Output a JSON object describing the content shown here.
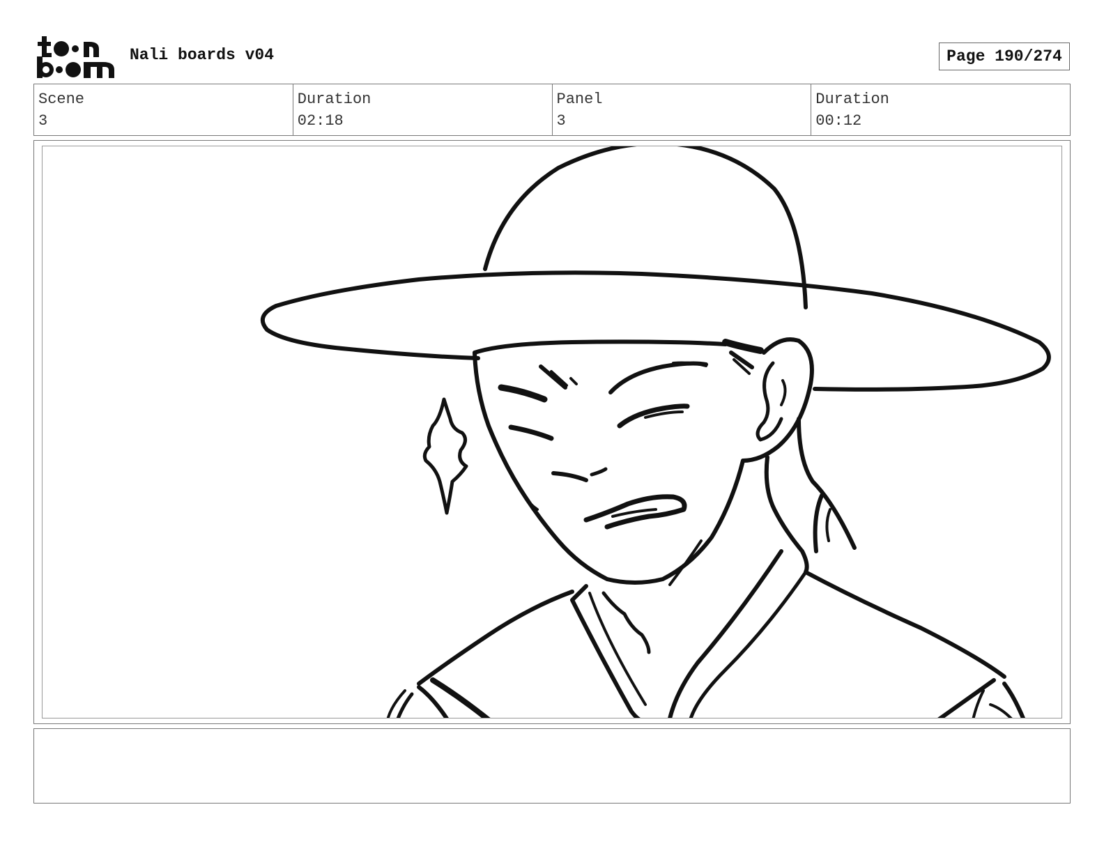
{
  "header": {
    "logo_text": "toon boom",
    "document_title": "Nali boards v04",
    "page_label": "Page 190/274"
  },
  "info": {
    "scene_label": "Scene",
    "scene_value": "3",
    "scene_duration_label": "Duration",
    "scene_duration_value": "02:18",
    "panel_label": "Panel",
    "panel_value": "3",
    "panel_duration_label": "Duration",
    "panel_duration_value": "00:12"
  },
  "panel": {
    "drawing": "sketch-character-wide-brim-hat"
  },
  "notes": {
    "text": ""
  }
}
